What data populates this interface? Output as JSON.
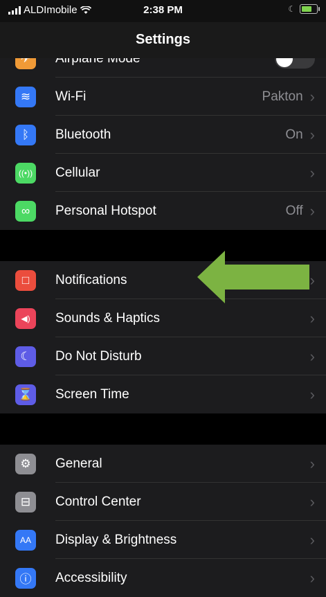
{
  "status_bar": {
    "carrier": "ALDImobile",
    "time": "2:38 PM"
  },
  "header": {
    "title": "Settings"
  },
  "groups": [
    [
      {
        "label": "Airplane Mode",
        "value": "",
        "icon": "airplane-icon",
        "color": "#f09a37",
        "toggle": true
      },
      {
        "label": "Wi-Fi",
        "value": "Pakton",
        "icon": "wifi-icon",
        "color": "#3478f6"
      },
      {
        "label": "Bluetooth",
        "value": "On",
        "icon": "bluetooth-icon",
        "color": "#3478f6"
      },
      {
        "label": "Cellular",
        "value": "",
        "icon": "cellular-icon",
        "color": "#4cd964"
      },
      {
        "label": "Personal Hotspot",
        "value": "Off",
        "icon": "hotspot-icon",
        "color": "#4cd964"
      }
    ],
    [
      {
        "label": "Notifications",
        "value": "",
        "icon": "notifications-icon",
        "color": "#eb4d3d"
      },
      {
        "label": "Sounds & Haptics",
        "value": "",
        "icon": "sounds-icon",
        "color": "#eb445a"
      },
      {
        "label": "Do Not Disturb",
        "value": "",
        "icon": "moon-icon",
        "color": "#5e5ce6"
      },
      {
        "label": "Screen Time",
        "value": "",
        "icon": "hourglass-icon",
        "color": "#5e5ce6"
      }
    ],
    [
      {
        "label": "General",
        "value": "",
        "icon": "gear-icon",
        "color": "#8e8e93"
      },
      {
        "label": "Control Center",
        "value": "",
        "icon": "control-center-icon",
        "color": "#8e8e93"
      },
      {
        "label": "Display & Brightness",
        "value": "",
        "icon": "display-icon",
        "color": "#3478f6"
      },
      {
        "label": "Accessibility",
        "value": "",
        "icon": "accessibility-icon",
        "color": "#3478f6"
      }
    ]
  ],
  "annotation": {
    "arrow_color": "#7cb342",
    "target": "Notifications"
  }
}
